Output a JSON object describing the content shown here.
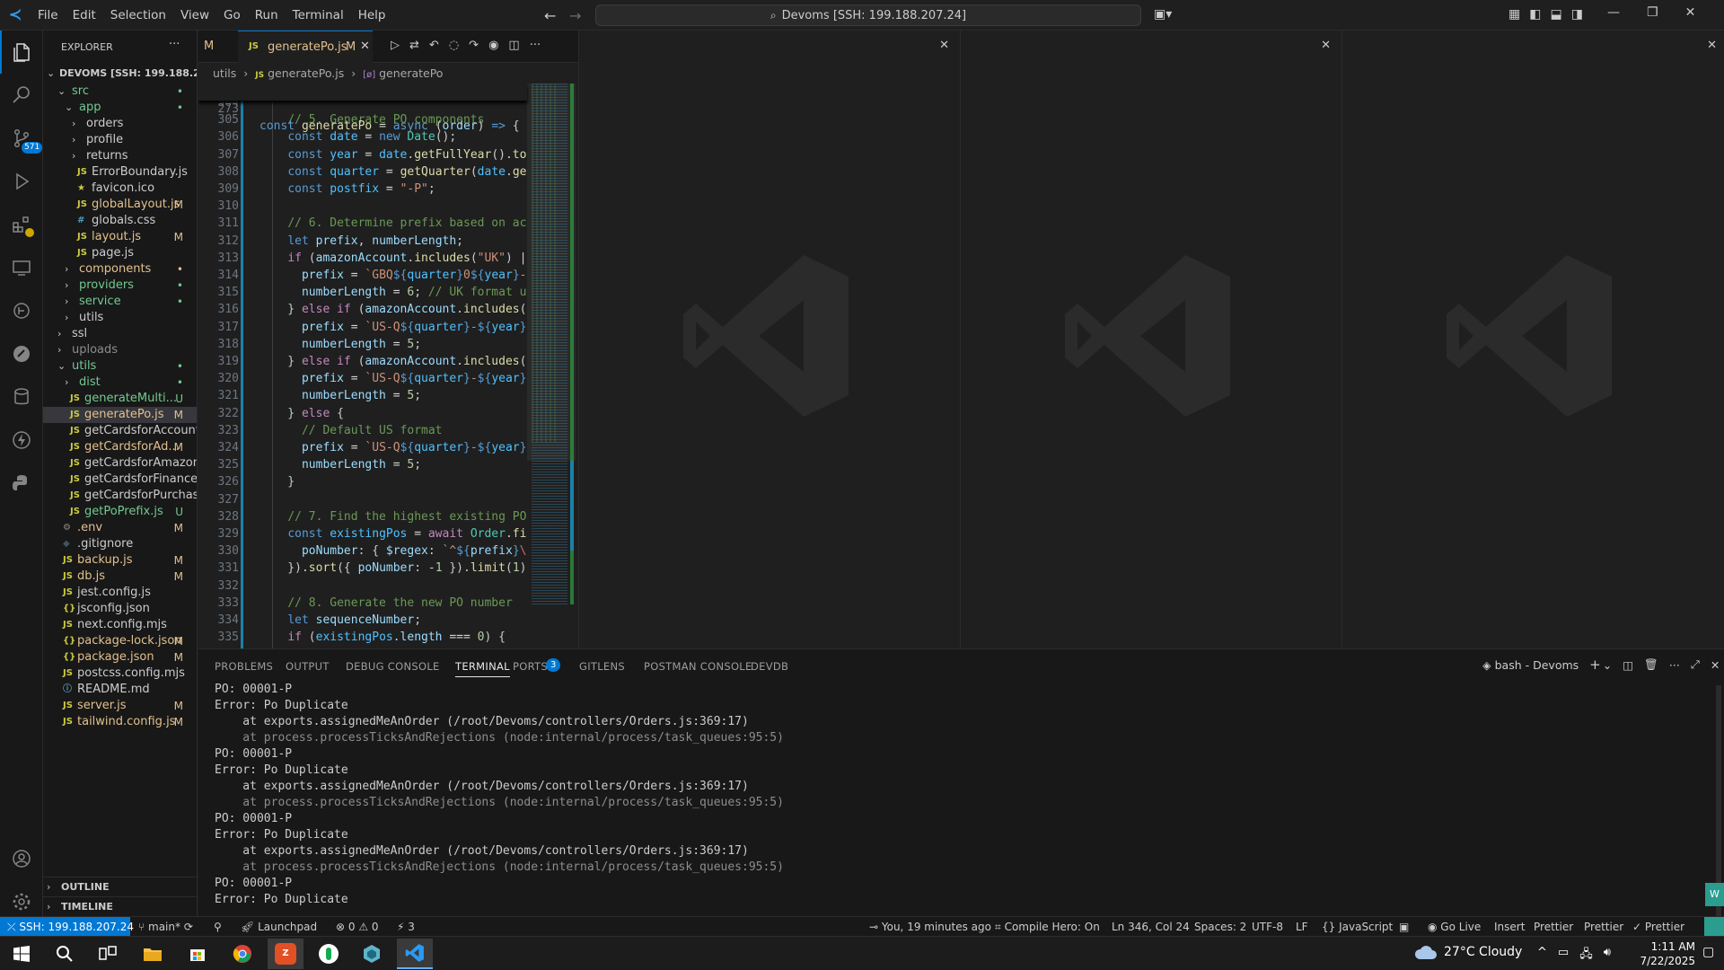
{
  "menu": [
    "File",
    "Edit",
    "Selection",
    "View",
    "Go",
    "Run",
    "Terminal",
    "Help"
  ],
  "command_center": "Devoms [SSH: 199.188.207.24]",
  "explorer": {
    "title": "EXPLORER",
    "root": "DEVOMS [SSH: 199.188.20...",
    "items": [
      {
        "label": "src",
        "type": "folder-open",
        "depth": 1,
        "badge": "•",
        "color": "#73c991"
      },
      {
        "label": "app",
        "type": "folder-open",
        "depth": 2,
        "badge": "•",
        "color": "#73c991"
      },
      {
        "label": "orders",
        "type": "folder",
        "depth": 3,
        "badge": "",
        "color": "#cccccc"
      },
      {
        "label": "profile",
        "type": "folder",
        "depth": 3,
        "badge": "",
        "color": "#cccccc"
      },
      {
        "label": "returns",
        "type": "folder",
        "depth": 3,
        "badge": "",
        "color": "#cccccc"
      },
      {
        "label": "ErrorBoundary.js",
        "type": "js",
        "depth": 3,
        "badge": "",
        "color": "#cccccc"
      },
      {
        "label": "favicon.ico",
        "type": "star",
        "depth": 3,
        "badge": "",
        "color": "#cccccc"
      },
      {
        "label": "globalLayout.js",
        "type": "js",
        "depth": 3,
        "badge": "M",
        "color": "#e2c08d"
      },
      {
        "label": "globals.css",
        "type": "css",
        "depth": 3,
        "badge": "",
        "color": "#cccccc"
      },
      {
        "label": "layout.js",
        "type": "js",
        "depth": 3,
        "badge": "M",
        "color": "#e2c08d"
      },
      {
        "label": "page.js",
        "type": "js",
        "depth": 3,
        "badge": "",
        "color": "#cccccc"
      },
      {
        "label": "components",
        "type": "folder",
        "depth": 2,
        "badge": "•",
        "color": "#e2c08d"
      },
      {
        "label": "providers",
        "type": "folder",
        "depth": 2,
        "badge": "•",
        "color": "#73c991"
      },
      {
        "label": "service",
        "type": "folder",
        "depth": 2,
        "badge": "•",
        "color": "#73c991"
      },
      {
        "label": "utils",
        "type": "folder",
        "depth": 2,
        "badge": "",
        "color": "#cccccc"
      },
      {
        "label": "ssl",
        "type": "folder",
        "depth": 1,
        "badge": "",
        "color": "#cccccc"
      },
      {
        "label": "uploads",
        "type": "folder",
        "depth": 1,
        "badge": "",
        "color": "#8c8c8c"
      },
      {
        "label": "utils",
        "type": "folder-open",
        "depth": 1,
        "badge": "•",
        "color": "#73c991"
      },
      {
        "label": "dist",
        "type": "folder",
        "depth": 2,
        "badge": "•",
        "color": "#73c991"
      },
      {
        "label": "generateMulti...",
        "type": "js",
        "depth": 2,
        "badge": "U",
        "color": "#73c991"
      },
      {
        "label": "generatePo.js",
        "type": "js",
        "depth": 2,
        "badge": "M",
        "color": "#e2c08d",
        "selected": true
      },
      {
        "label": "getCardsforAccount.js",
        "type": "js",
        "depth": 2,
        "badge": "",
        "color": "#cccccc"
      },
      {
        "label": "getCardsforAd...",
        "type": "js",
        "depth": 2,
        "badge": "M",
        "color": "#e2c08d"
      },
      {
        "label": "getCardsforAmazon.js",
        "type": "js",
        "depth": 2,
        "badge": "",
        "color": "#cccccc"
      },
      {
        "label": "getCardsforFinance.js",
        "type": "js",
        "depth": 2,
        "badge": "",
        "color": "#cccccc"
      },
      {
        "label": "getCardsforPurchasi...",
        "type": "js",
        "depth": 2,
        "badge": "",
        "color": "#cccccc"
      },
      {
        "label": "getPoPrefix.js",
        "type": "js",
        "depth": 2,
        "badge": "U",
        "color": "#73c991"
      },
      {
        "label": ".env",
        "type": "gear",
        "depth": 1,
        "badge": "M",
        "color": "#e2c08d"
      },
      {
        "label": ".gitignore",
        "type": "git",
        "depth": 1,
        "badge": "",
        "color": "#cccccc"
      },
      {
        "label": "backup.js",
        "type": "js",
        "depth": 1,
        "badge": "M",
        "color": "#e2c08d"
      },
      {
        "label": "db.js",
        "type": "js",
        "depth": 1,
        "badge": "M",
        "color": "#e2c08d"
      },
      {
        "label": "jest.config.js",
        "type": "js",
        "depth": 1,
        "badge": "",
        "color": "#cccccc"
      },
      {
        "label": "jsconfig.json",
        "type": "json",
        "depth": 1,
        "badge": "",
        "color": "#cccccc"
      },
      {
        "label": "next.config.mjs",
        "type": "js",
        "depth": 1,
        "badge": "",
        "color": "#cccccc"
      },
      {
        "label": "package-lock.json",
        "type": "json",
        "depth": 1,
        "badge": "M",
        "color": "#e2c08d"
      },
      {
        "label": "package.json",
        "type": "json",
        "depth": 1,
        "badge": "M",
        "color": "#e2c08d"
      },
      {
        "label": "postcss.config.mjs",
        "type": "js",
        "depth": 1,
        "badge": "",
        "color": "#cccccc"
      },
      {
        "label": "README.md",
        "type": "info",
        "depth": 1,
        "badge": "",
        "color": "#cccccc"
      },
      {
        "label": "server.js",
        "type": "js",
        "depth": 1,
        "badge": "M",
        "color": "#e2c08d"
      },
      {
        "label": "tailwind.config.js",
        "type": "js",
        "depth": 1,
        "badge": "M",
        "color": "#e2c08d"
      }
    ],
    "outline": "OUTLINE",
    "timeline": "TIMELINE"
  },
  "editor": {
    "prev_tab_suffix": "M",
    "tab": {
      "label": "generatePo.js",
      "badge": "M"
    },
    "breadcrumb": [
      "utils",
      "generatePo.js",
      "generatePo"
    ],
    "sticky": {
      "ln": "273",
      "html": "<span class='kw'>const</span> <span class='fn'>generatePo</span> <span class='op'>=</span> <span class='kw'>async</span> (<span class='vr'>order</span>) <span class='kw'>=&gt;</span> {"
    },
    "lines": [
      {
        "ln": "304",
        "html": ""
      },
      {
        "ln": "305",
        "html": "    <span class='cm'>// 5. Generate PO components</span>"
      },
      {
        "ln": "306",
        "html": "    <span class='kw'>const</span> <span class='cs'>date</span> <span class='op'>=</span> <span class='kw'>new</span> <span class='ty'>Date</span>();"
      },
      {
        "ln": "307",
        "html": "    <span class='kw'>const</span> <span class='cs'>year</span> <span class='op'>=</span> <span class='cs'>date</span>.<span class='fn'>getFullYear</span>().<span class='fn'>toSt</span>"
      },
      {
        "ln": "308",
        "html": "    <span class='kw'>const</span> <span class='cs'>quarter</span> <span class='op'>=</span> <span class='fn'>getQuarter</span>(<span class='cs'>date</span>.<span class='fn'>getM</span>"
      },
      {
        "ln": "309",
        "html": "    <span class='kw'>const</span> <span class='cs'>postfix</span> <span class='op'>=</span> <span class='str'>\"-P\"</span>;"
      },
      {
        "ln": "310",
        "html": ""
      },
      {
        "ln": "311",
        "html": "    <span class='cm'>// 6. Determine prefix based on acco</span>"
      },
      {
        "ln": "312",
        "html": "    <span class='kw'>let</span> <span class='vr'>prefix</span>, <span class='vr'>numberLength</span>;"
      },
      {
        "ln": "313",
        "html": "    <span class='kw2'>if</span> (<span class='vr'>amazonAccount</span>.<span class='fn'>includes</span>(<span class='str'>\"UK\"</span>) <span class='op'>||</span>"
      },
      {
        "ln": "314",
        "html": "      <span class='vr'>prefix</span> <span class='op'>=</span> <span class='str'>`GBQ</span><span class='kw'>${</span><span class='cs'>quarter</span><span class='kw'>}</span><span class='str'>0</span><span class='kw'>${</span><span class='cs'>year</span><span class='kw'>}</span><span class='str'>-AZ</span>"
      },
      {
        "ln": "315",
        "html": "      <span class='vr'>numberLength</span> <span class='op'>=</span> <span class='nm'>6</span>; <span class='cm'>// UK format use</span>"
      },
      {
        "ln": "316",
        "html": "    } <span class='kw2'>else if</span> (<span class='vr'>amazonAccount</span>.<span class='fn'>includes</span>(<span class='str'>\"T</span>"
      },
      {
        "ln": "317",
        "html": "      <span class='vr'>prefix</span> <span class='op'>=</span> <span class='str'>`US-Q</span><span class='kw'>${</span><span class='cs'>quarter</span><span class='kw'>}</span><span class='str'>-</span><span class='kw'>${</span><span class='cs'>year</span><span class='kw'>}</span><span class='str'>-A</span>"
      },
      {
        "ln": "318",
        "html": "      <span class='vr'>numberLength</span> <span class='op'>=</span> <span class='nm'>5</span>;"
      },
      {
        "ln": "319",
        "html": "    } <span class='kw2'>else if</span> (<span class='vr'>amazonAccount</span>.<span class='fn'>includes</span>(<span class='str'>\"C</span>"
      },
      {
        "ln": "320",
        "html": "      <span class='vr'>prefix</span> <span class='op'>=</span> <span class='str'>`US-Q</span><span class='kw'>${</span><span class='cs'>quarter</span><span class='kw'>}</span><span class='str'>-</span><span class='kw'>${</span><span class='cs'>year</span><span class='kw'>}</span><span class='str'>-$</span>"
      },
      {
        "ln": "321",
        "html": "      <span class='vr'>numberLength</span> <span class='op'>=</span> <span class='nm'>5</span>;"
      },
      {
        "ln": "322",
        "html": "    } <span class='kw2'>else</span> {"
      },
      {
        "ln": "323",
        "html": "      <span class='cm'>// Default US format</span>"
      },
      {
        "ln": "324",
        "html": "      <span class='vr'>prefix</span> <span class='op'>=</span> <span class='str'>`US-Q</span><span class='kw'>${</span><span class='cs'>quarter</span><span class='kw'>}</span><span class='str'>-</span><span class='kw'>${</span><span class='cs'>year</span><span class='kw'>}</span><span class='str'>-`</span>"
      },
      {
        "ln": "325",
        "html": "      <span class='vr'>numberLength</span> <span class='op'>=</span> <span class='nm'>5</span>;"
      },
      {
        "ln": "326",
        "html": "    }"
      },
      {
        "ln": "327",
        "html": ""
      },
      {
        "ln": "328",
        "html": "    <span class='cm'>// 7. Find the highest existing PO n</span>"
      },
      {
        "ln": "329",
        "html": "    <span class='kw'>const</span> <span class='cs'>existingPos</span> <span class='op'>=</span> <span class='kw2'>await</span> <span class='ty'>Order</span>.<span class='fn'>find</span>"
      },
      {
        "ln": "330",
        "html": "      <span class='vr'>poNumber</span>: { <span class='vr'>$regex</span>: <span class='str'>`^</span><span class='kw'>${</span><span class='vr'>prefix</span><span class='kw'>}</span><span class='rx'>\\\\d</span>"
      },
      {
        "ln": "331",
        "html": "    }).<span class='fn'>sort</span>({ <span class='vr'>poNumber</span>: <span class='op'>-</span><span class='nm'>1</span> }).<span class='fn'>limit</span>(<span class='nm'>1</span>);"
      },
      {
        "ln": "332",
        "html": ""
      },
      {
        "ln": "333",
        "html": "    <span class='cm'>// 8. Generate the new PO number</span>"
      },
      {
        "ln": "334",
        "html": "    <span class='kw'>let</span> <span class='vr'>sequenceNumber</span>;"
      },
      {
        "ln": "335",
        "html": "    <span class='kw2'>if</span> (<span class='cs'>existingPos</span>.<span class='vr'>length</span> <span class='op'>===</span> <span class='nm'>0</span>) {"
      }
    ]
  },
  "panel": {
    "tabs": [
      "PROBLEMS",
      "OUTPUT",
      "DEBUG CONSOLE",
      "TERMINAL",
      "PORTS",
      "GITLENS",
      "POSTMAN CONSOLE",
      "DEVDB"
    ],
    "ports_badge": "3",
    "active_tab": "TERMINAL",
    "terminal_name": "bash - Devoms",
    "lines": [
      {
        "t": "PO: 00001-P",
        "c": "#cccccc"
      },
      {
        "t": "Error: Po Duplicate",
        "c": "#cccccc"
      },
      {
        "t": "    at exports.assignedMeAnOrder (/root/Devoms/controllers/Orders.js:369:17)",
        "c": "#cccccc",
        "dim": true
      },
      {
        "t": "    at process.processTicksAndRejections (node:internal/process/task_queues:95:5)",
        "c": "#8c8c8c"
      },
      {
        "t": "PO: 00001-P",
        "c": "#cccccc"
      },
      {
        "t": "Error: Po Duplicate",
        "c": "#cccccc"
      },
      {
        "t": "    at exports.assignedMeAnOrder (/root/Devoms/controllers/Orders.js:369:17)",
        "c": "#cccccc",
        "dim": true
      },
      {
        "t": "    at process.processTicksAndRejections (node:internal/process/task_queues:95:5)",
        "c": "#8c8c8c"
      },
      {
        "t": "PO: 00001-P",
        "c": "#cccccc"
      },
      {
        "t": "Error: Po Duplicate",
        "c": "#cccccc"
      },
      {
        "t": "    at exports.assignedMeAnOrder (/root/Devoms/controllers/Orders.js:369:17)",
        "c": "#cccccc",
        "dim": true
      },
      {
        "t": "    at process.processTicksAndRejections (node:internal/process/task_queues:95:5)",
        "c": "#8c8c8c"
      },
      {
        "t": "PO: 00001-P",
        "c": "#cccccc"
      },
      {
        "t": "Error: Po Duplicate",
        "c": "#cccccc"
      }
    ]
  },
  "statusbar": {
    "remote": "SSH: 199.188.207.24",
    "branch": "main*",
    "errors": "0",
    "warnings": "0",
    "ports": "3",
    "launchpad": "Launchpad",
    "blame": "You, 19 minutes ago",
    "compile_hero": "Compile Hero: On",
    "cursor": "Ln 346, Col 24",
    "spaces": "Spaces: 2",
    "encoding": "UTF-8",
    "eol": "LF",
    "language": "JavaScript",
    "golive": "Go Live",
    "insert": "Insert",
    "prettier1": "Prettier",
    "prettier2": "Prettier",
    "prettier3": "Prettier"
  },
  "taskbar": {
    "weather": "27°C  Cloudy",
    "time": "1:11 AM",
    "date": "7/22/2025"
  },
  "colors": {
    "accent": "#0078d4",
    "remote": "#16825d"
  }
}
